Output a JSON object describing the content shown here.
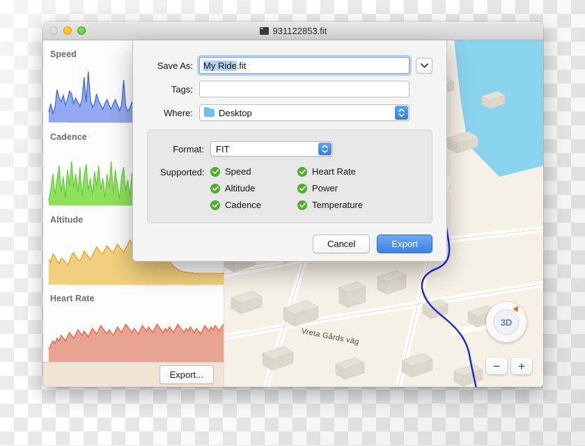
{
  "window": {
    "title": "931122853.fit",
    "title_icon": "fit-document-icon",
    "traffic_lights": [
      {
        "name": "close",
        "state": "inactive"
      },
      {
        "name": "minimize",
        "state": "active"
      },
      {
        "name": "zoom",
        "state": "active"
      }
    ]
  },
  "sidebar": {
    "charts": [
      {
        "label": "Speed",
        "metric": "speed"
      },
      {
        "label": "Cadence",
        "metric": "cadence"
      },
      {
        "label": "Altitude",
        "metric": "altitude"
      },
      {
        "label": "Heart Rate",
        "metric": "heart_rate"
      }
    ],
    "export_button": "Export..."
  },
  "map": {
    "street_label": "Vreta Gårds väg",
    "compass_label": "3D",
    "zoom_in": "+",
    "zoom_out": "−",
    "colors": {
      "land": "#f6f1e7",
      "water": "#89d3ef",
      "road": "#ffffff",
      "building": "#e6e1d7",
      "track": "#1028e0"
    }
  },
  "sheet": {
    "save_as": {
      "label": "Save As:",
      "value_selected": "My Ride",
      "value_rest": ".fit",
      "placeholder": "",
      "expand_icon": "chevron-down-icon"
    },
    "tags": {
      "label": "Tags:",
      "value": "",
      "placeholder": ""
    },
    "where": {
      "label": "Where:",
      "value": "Desktop",
      "icon": "folder-icon"
    },
    "format": {
      "label": "Format:",
      "value": "FIT"
    },
    "supported": {
      "label": "Supported:",
      "column_left": [
        "Speed",
        "Altitude",
        "Cadence"
      ],
      "column_right": [
        "Heart Rate",
        "Power",
        "Temperature"
      ],
      "check_color": "#4fb027"
    },
    "buttons": {
      "cancel": "Cancel",
      "export": "Export"
    }
  },
  "chart_data": {
    "type": "area",
    "title": "Ride metrics",
    "charts": [
      {
        "name": "Speed",
        "color_line": "#3f68e0",
        "color_fill": "#93a9ef",
        "ylabel": "Speed",
        "values": [
          14,
          22,
          45,
          34,
          30,
          27,
          36,
          28,
          24,
          20,
          26,
          38,
          33,
          27,
          22,
          18,
          30,
          55,
          24,
          60,
          30,
          22,
          26,
          38,
          28,
          24,
          20,
          18,
          22,
          28,
          24,
          20,
          26,
          30,
          24,
          18,
          22,
          50,
          24,
          18,
          20,
          26,
          22,
          18,
          24,
          30,
          26,
          22,
          30,
          26,
          20,
          24,
          28,
          22,
          26,
          48,
          30,
          24,
          22,
          28,
          34,
          30,
          26,
          24,
          22,
          26,
          30,
          34,
          52,
          36,
          30,
          26,
          24,
          30,
          40,
          34,
          30,
          36,
          32,
          28,
          34,
          46,
          38,
          32,
          36,
          30,
          34,
          30,
          28,
          34
        ]
      },
      {
        "name": "Cadence",
        "color_line": "#62c73a",
        "color_fill": "#8fe05c",
        "ylabel": "Cadence",
        "values": [
          8,
          22,
          40,
          16,
          34,
          48,
          20,
          36,
          12,
          44,
          28,
          52,
          24,
          40,
          18,
          46,
          30,
          14,
          38,
          50,
          22,
          36,
          16,
          42,
          26,
          48,
          20,
          34,
          12,
          40,
          24,
          52,
          18,
          44,
          30,
          10,
          38,
          46,
          22,
          34,
          14,
          42,
          28,
          50,
          20,
          36,
          16,
          44,
          24,
          48,
          30,
          12,
          40,
          34,
          18,
          46,
          26,
          38,
          14,
          50,
          22,
          36,
          20,
          44,
          28,
          40,
          16,
          34,
          48,
          24,
          38,
          12,
          46,
          30,
          42,
          18,
          36,
          50,
          22,
          40,
          26,
          34,
          14,
          44,
          28,
          48,
          20,
          36,
          30,
          42
        ]
      },
      {
        "name": "Altitude",
        "color_line": "#e8a020",
        "color_fill": "#f1cf7e",
        "ylabel": "Altitude",
        "values": [
          30,
          26,
          38,
          34,
          28,
          24,
          32,
          30,
          26,
          22,
          28,
          36,
          40,
          34,
          30,
          28,
          34,
          42,
          38,
          34,
          30,
          36,
          42,
          48,
          44,
          40,
          38,
          44,
          50,
          46,
          42,
          40,
          46,
          52,
          48,
          44,
          40,
          46,
          52,
          58,
          54,
          50,
          46,
          52,
          58,
          62,
          58,
          54,
          50,
          56,
          62,
          66,
          62,
          58,
          54,
          50,
          46,
          42,
          38,
          34,
          30,
          26,
          22,
          18,
          14,
          12,
          10,
          9,
          8,
          8,
          7,
          7,
          6,
          6,
          6,
          5,
          5,
          5,
          5,
          5,
          5,
          5,
          5,
          5,
          5,
          5,
          5,
          5,
          5,
          5
        ]
      },
      {
        "name": "Heart Rate",
        "color_line": "#e8603c",
        "color_fill": "#e8a391",
        "ylabel": "Heart Rate",
        "values": [
          18,
          24,
          30,
          26,
          34,
          30,
          38,
          34,
          30,
          36,
          42,
          38,
          34,
          40,
          46,
          42,
          38,
          44,
          40,
          36,
          42,
          48,
          44,
          40,
          46,
          52,
          48,
          44,
          40,
          46,
          42,
          38,
          44,
          50,
          46,
          42,
          48,
          54,
          50,
          46,
          42,
          48,
          44,
          40,
          46,
          52,
          48,
          44,
          50,
          46,
          42,
          48,
          54,
          50,
          46,
          52,
          48,
          44,
          50,
          46,
          52,
          48,
          44,
          50,
          56,
          52,
          48,
          44,
          50,
          46,
          52,
          48,
          44,
          50,
          46,
          42,
          48,
          54,
          50,
          46,
          52,
          48,
          44,
          50,
          46,
          52,
          48,
          44,
          50,
          54
        ]
      }
    ]
  }
}
